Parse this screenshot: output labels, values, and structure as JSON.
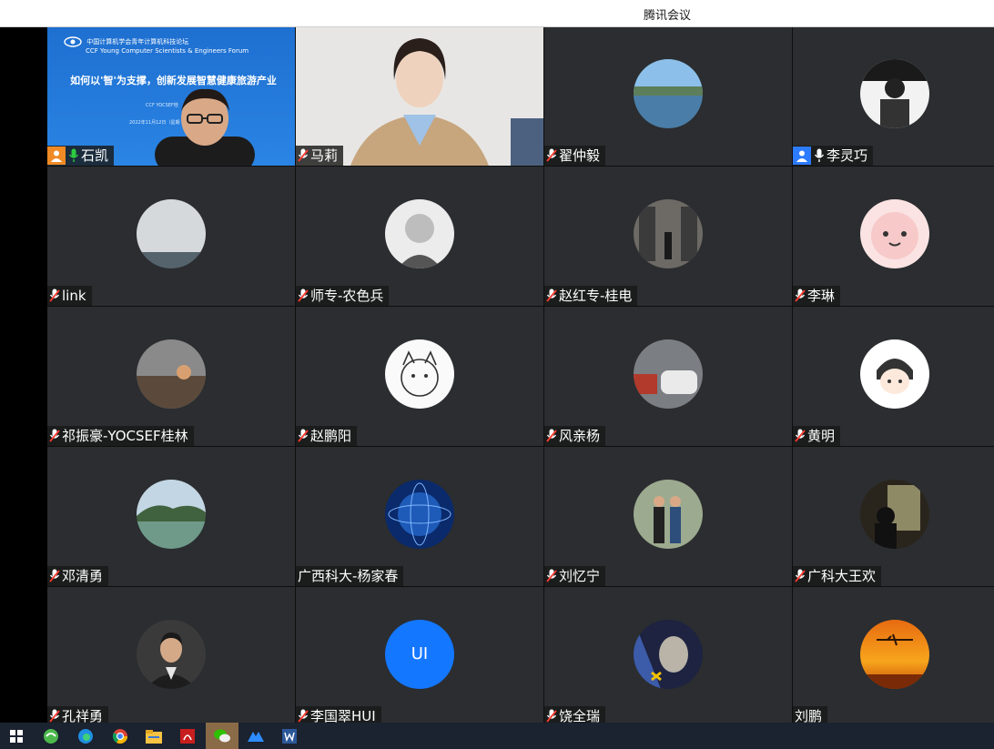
{
  "window": {
    "title": "腾讯会议"
  },
  "shared_screen": {
    "org_line": "中国计算机学会青年计算机科技论坛",
    "org_line_en": "CCF Young Computer Scientists & Engineers Forum",
    "headline": "如何以'智'为支撑，创新发展智慧健康旅游产业",
    "sub": "CCF YOCSEF桂",
    "date": "2022年11月12日（星期"
  },
  "participants": [
    {
      "name": "石凯",
      "badge": "host-orange",
      "mic": "on"
    },
    {
      "name": "马莉",
      "mic": "muted"
    },
    {
      "name": "翟仲毅",
      "mic": "muted"
    },
    {
      "name": "李灵巧",
      "badge": "cohost-blue",
      "mic": "on"
    },
    {
      "name": "link",
      "mic": "muted"
    },
    {
      "name": "师专-农色兵",
      "mic": "muted"
    },
    {
      "name": "赵红专-桂电",
      "mic": "muted"
    },
    {
      "name": "李琳",
      "mic": "muted"
    },
    {
      "name": "祁振豪-YOCSEF桂林",
      "mic": "muted"
    },
    {
      "name": "赵鹏阳",
      "mic": "muted"
    },
    {
      "name": "风亲杨",
      "mic": "muted"
    },
    {
      "name": "黄明",
      "mic": "muted"
    },
    {
      "name": "邓清勇",
      "mic": "muted"
    },
    {
      "name": "广西科大-杨家春",
      "mic": "none"
    },
    {
      "name": "刘忆宁",
      "mic": "muted"
    },
    {
      "name": "广科大王欢",
      "mic": "muted"
    },
    {
      "name": "孔祥勇",
      "mic": "muted"
    },
    {
      "name": "李国翠HUI",
      "mic": "muted",
      "initials": "UI"
    },
    {
      "name": "饶全瑞",
      "mic": "muted"
    },
    {
      "name": "刘鹏",
      "mic": "none"
    }
  ],
  "colors": {
    "tile_bg": "#2b2d30",
    "speaking_border": "#2ecc40",
    "host_badge": "#f08a24",
    "cohost_badge": "#2d7bff"
  }
}
